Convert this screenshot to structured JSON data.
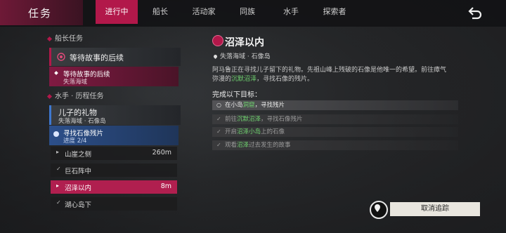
{
  "header": {
    "title": "任务",
    "tabs": [
      "进行中",
      "船长",
      "活动家",
      "同族",
      "水手",
      "探索者"
    ],
    "active_tab": "进行中"
  },
  "left": {
    "section_captain": "船长任务",
    "captain_quest": {
      "title": "等待故事的后续",
      "sub_title": "等待故事的后续",
      "sub_location": "失落海域"
    },
    "section_sailor": "水手 · 历程任务",
    "sailor_quest": {
      "title": "儿子的礼物",
      "location": "失落海域 · 石像岛",
      "sub_title": "寻找石像残片",
      "sub_progress": "进度 2/4"
    },
    "rows": [
      {
        "label": "山崖之侧",
        "dist": "260m",
        "mark": "▸"
      },
      {
        "label": "巨石阵中",
        "dist": "",
        "mark": "✓"
      },
      {
        "label": "沼泽以内",
        "dist": "8m",
        "mark": "▸"
      },
      {
        "label": "湖心岛下",
        "dist": "",
        "mark": "✓"
      }
    ]
  },
  "detail": {
    "title": "沼泽以内",
    "location": "失落海域 · 石像岛",
    "desc_1": "阿马鲁正在寻找儿子留下的礼物。先祖山峰上残破的石像是他唯一的希望。前往瘴气",
    "desc_2a": "弥漫的",
    "desc_2_hl": "沉默沼泽",
    "desc_2b": "，寻找石像的残片。",
    "goals_head": "完成以下目标：",
    "goals": [
      {
        "a": "在小岛",
        "hl": "洞窟",
        "b": "，寻找残片",
        "current": true,
        "mark": "○"
      },
      {
        "a": "前往",
        "hl": "沉默沼泽",
        "b": "，寻找石像残片",
        "current": false,
        "mark": "✓"
      },
      {
        "a": "开启",
        "hl": "沼泽小岛",
        "b": "上的石像",
        "current": false,
        "mark": "✓"
      },
      {
        "a": "观看",
        "hl": "沼泽",
        "b": "过去发生的故事",
        "current": false,
        "mark": "✓"
      }
    ]
  },
  "footer": {
    "cancel_label": "取消追踪"
  },
  "colors": {
    "accent": "#b2184a",
    "highlight": "#6fd16f",
    "blue_card": "#2c4f8a"
  }
}
